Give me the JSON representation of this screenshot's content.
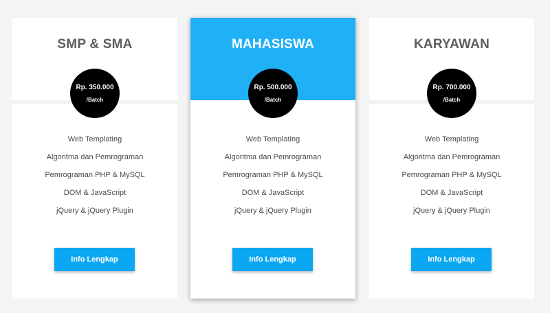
{
  "cards": [
    {
      "title": "SMP & SMA",
      "price": "Rp. 350.000",
      "unit": "/Batch",
      "features": [
        "Web Templating",
        "Algoritma dan Pemrograman",
        "Pemrograman PHP & MySQL",
        "DOM & JavaScript",
        "jQuery & jQuery Plugin"
      ],
      "button_label": "Info Lengkap"
    },
    {
      "title": "MAHASISWA",
      "price": "Rp. 500.000",
      "unit": "/Batch",
      "features": [
        "Web Templating",
        "Algoritma dan Pemrograman",
        "Pemrograman PHP & MySQL",
        "DOM & JavaScript",
        "jQuery & jQuery Plugin"
      ],
      "button_label": "Info Lengkap",
      "highlighted": true
    },
    {
      "title": "KARYAWAN",
      "price": "Rp. 700.000",
      "unit": "/Batch",
      "features": [
        "Web Templating",
        "Algoritma dan Pemrograman",
        "Pemrograman PHP & MySQL",
        "DOM & JavaScript",
        "jQuery & jQuery Plugin"
      ],
      "button_label": "Info Lengkap"
    }
  ],
  "colors": {
    "page_background": "#f4f4f4",
    "card_background": "#ffffff",
    "highlight_header": "#1fb0f5",
    "price_circle": "#000000",
    "button": "#0ca7f2",
    "title_text": "#5e5e5e",
    "feature_text": "#4a4a4a"
  }
}
